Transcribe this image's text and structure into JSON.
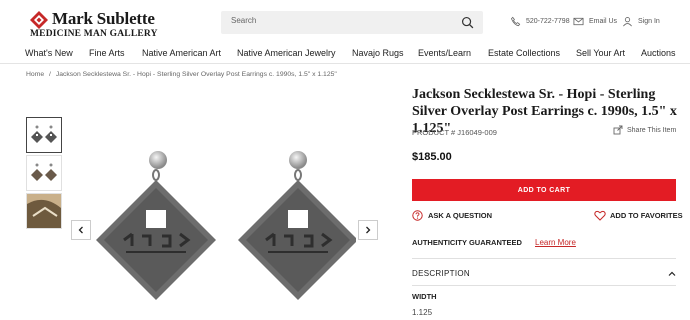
{
  "brand": {
    "line1": "Mark Sublette",
    "line2": "MEDICINE MAN GALLERY",
    "accent": "#c62828"
  },
  "search": {
    "placeholder": "Search"
  },
  "utility": {
    "phone": "520-722-7798",
    "email": "Email Us",
    "signin": "Sign In"
  },
  "nav": [
    "What's New",
    "Fine Arts",
    "Native American Art",
    "Native American Jewelry",
    "Navajo Rugs",
    "Events/Learn",
    "Estate Collections",
    "Sell Your Art",
    "Auctions"
  ],
  "breadcrumb": {
    "home": "Home",
    "sep": "/",
    "current": "Jackson Secklestewa Sr. - Hopi - Sterling Silver Overlay Post Earrings c. 1990s, 1.5\" x 1.125\""
  },
  "product": {
    "title": "Jackson Secklestewa Sr. - Hopi - Sterling Silver Overlay Post Earrings c. 1990s, 1.5\" x 1.125\"",
    "code_label": "PRODUCT #",
    "code": "J16049-009",
    "share": "Share This Item",
    "price": "$185.00",
    "add_to_cart": "ADD TO CART",
    "ask": "ASK A QUESTION",
    "favorites": "ADD TO FAVORITES",
    "authenticity": "AUTHENTICITY GUARANTEED",
    "learn_more": "Learn More",
    "description": "DESCRIPTION",
    "width_label": "WIDTH",
    "width_value": "1.125"
  },
  "colors": {
    "cart": "#e31c24",
    "text": "#222222"
  }
}
